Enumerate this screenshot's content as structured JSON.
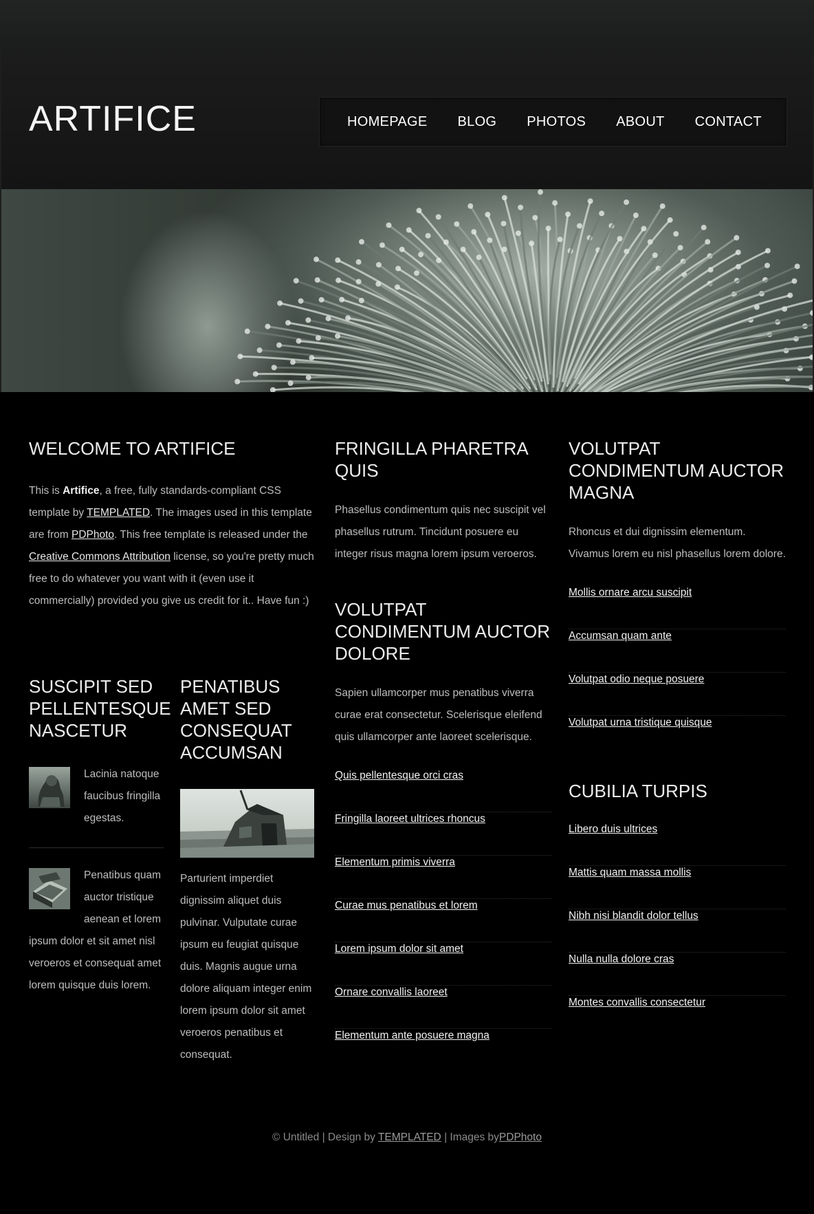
{
  "header": {
    "logo": "ARTIFICE",
    "nav": [
      "HOMEPAGE",
      "BLOG",
      "PHOTOS",
      "ABOUT",
      "CONTACT"
    ]
  },
  "welcome": {
    "title": "WELCOME TO ARTIFICE",
    "p1": "This is ",
    "brand": "Artifice",
    "p2": ", a free, fully standards-compliant CSS template by ",
    "link1": "TEMPLATED",
    "p3": ". The images used in this template are from ",
    "link2": "PDPhoto",
    "p4": ". This free template is released under the ",
    "link3": "Creative Commons Attribution",
    "p5": " license, so you're pretty much free to do whatever you want with it (even use it commercially) provided you give us credit for it.. Have fun :)"
  },
  "suscipit": {
    "title": "SUSCIPIT SED PELLENTESQUE NASCETUR",
    "item1": "Lacinia natoque faucibus fringilla egestas.",
    "item2": "Penatibus quam auctor tristique aenean et lorem ipsum dolor et sit amet nisl veroeros et consequat amet lorem quisque duis lorem."
  },
  "penatibus": {
    "title": "PENATIBUS AMET SED CONSEQUAT ACCUMSAN",
    "text": "Parturient imperdiet dignissim aliquet duis pulvinar. Vulputate curae ipsum eu feugiat quisque duis. Magnis augue urna dolore aliquam integer enim lorem ipsum dolor sit amet veroeros penatibus et consequat."
  },
  "fringilla": {
    "title": "FRINGILLA PHARETRA QUIS",
    "text": "Phasellus condimentum quis nec suscipit vel phasellus rutrum. Tincidunt posuere eu integer risus magna lorem ipsum veroeros."
  },
  "volutpat_dolore": {
    "title": "VOLUTPAT CONDIMENTUM AUCTOR DOLORE",
    "text": "Sapien ullamcorper mus penatibus viverra curae erat consectetur. Scelerisque eleifend quis ullamcorper ante laoreet scelerisque.",
    "links": [
      "Quis pellentesque orci cras",
      "Fringilla laoreet ultrices rhoncus",
      "Elementum primis viverra",
      "Curae mus penatibus et lorem",
      "Lorem ipsum dolor sit amet",
      "Ornare convallis laoreet",
      "Elementum ante posuere magna"
    ]
  },
  "volutpat_magna": {
    "title": "VOLUTPAT CONDIMENTUM AUCTOR MAGNA",
    "text": "Rhoncus et dui dignissim elementum. Vivamus lorem eu nisl phasellus lorem dolore.",
    "links": [
      "Mollis ornare arcu suscipit",
      "Accumsan quam ante",
      "Volutpat odio neque posuere",
      "Volutpat urna tristique quisque"
    ]
  },
  "cubilia": {
    "title": "CUBILIA TURPIS",
    "links": [
      "Libero duis ultrices",
      "Mattis quam massa mollis",
      "Nibh nisi blandit dolor tellus",
      "Nulla nulla dolore cras",
      "Montes convallis consectetur"
    ]
  },
  "footer": {
    "t1": "© Untitled | Design by ",
    "link1": "TEMPLATED",
    "t2": " | Images by",
    "link2": "PDPhoto"
  }
}
